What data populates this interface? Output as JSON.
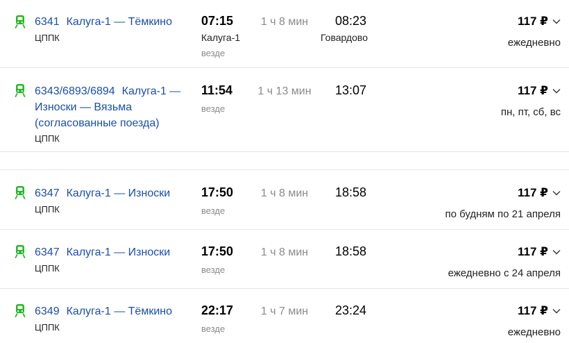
{
  "colors": {
    "link": "#1a4ea8",
    "icon": "#26b826",
    "muted": "#8a8a8a"
  },
  "rows": [
    {
      "number": "6341",
      "route": "Калуга-1 — Тёмкино",
      "carrier": "ЦППК",
      "dep_time": "07:15",
      "dep_station": "Калуга-1",
      "everywhere": "везде",
      "duration": "1 ч 8 мин",
      "arr_time": "08:23",
      "arr_station": "Говардово",
      "price": "117 ₽",
      "days": "ежедневно"
    },
    {
      "number": "6343/6893/6894",
      "route_line1": "Калуга-1 —",
      "route_line2": "Износки — Вязьма",
      "route_line3": "(согласованные поезда)",
      "carrier": "ЦППК",
      "dep_time": "11:54",
      "everywhere": "везде",
      "duration": "1 ч 13 мин",
      "arr_time": "13:07",
      "price": "117 ₽",
      "days": "пн, пт, сб, вс"
    },
    {
      "number": "6347",
      "route": "Калуга-1 — Износки",
      "carrier": "ЦППК",
      "dep_time": "17:50",
      "everywhere": "везде",
      "duration": "1 ч 8 мин",
      "arr_time": "18:58",
      "price": "117 ₽",
      "days": "по будням по 21 апреля"
    },
    {
      "number": "6347",
      "route": "Калуга-1 — Износки",
      "carrier": "ЦППК",
      "dep_time": "17:50",
      "everywhere": "везде",
      "duration": "1 ч 8 мин",
      "arr_time": "18:58",
      "price": "117 ₽",
      "days": "ежедневно с 24 апреля"
    },
    {
      "number": "6349",
      "route": "Калуга-1 — Тёмкино",
      "carrier": "ЦППК",
      "dep_time": "22:17",
      "everywhere": "везде",
      "duration": "1 ч 7 мин",
      "arr_time": "23:24",
      "price": "117 ₽",
      "days": "ежедневно"
    }
  ]
}
